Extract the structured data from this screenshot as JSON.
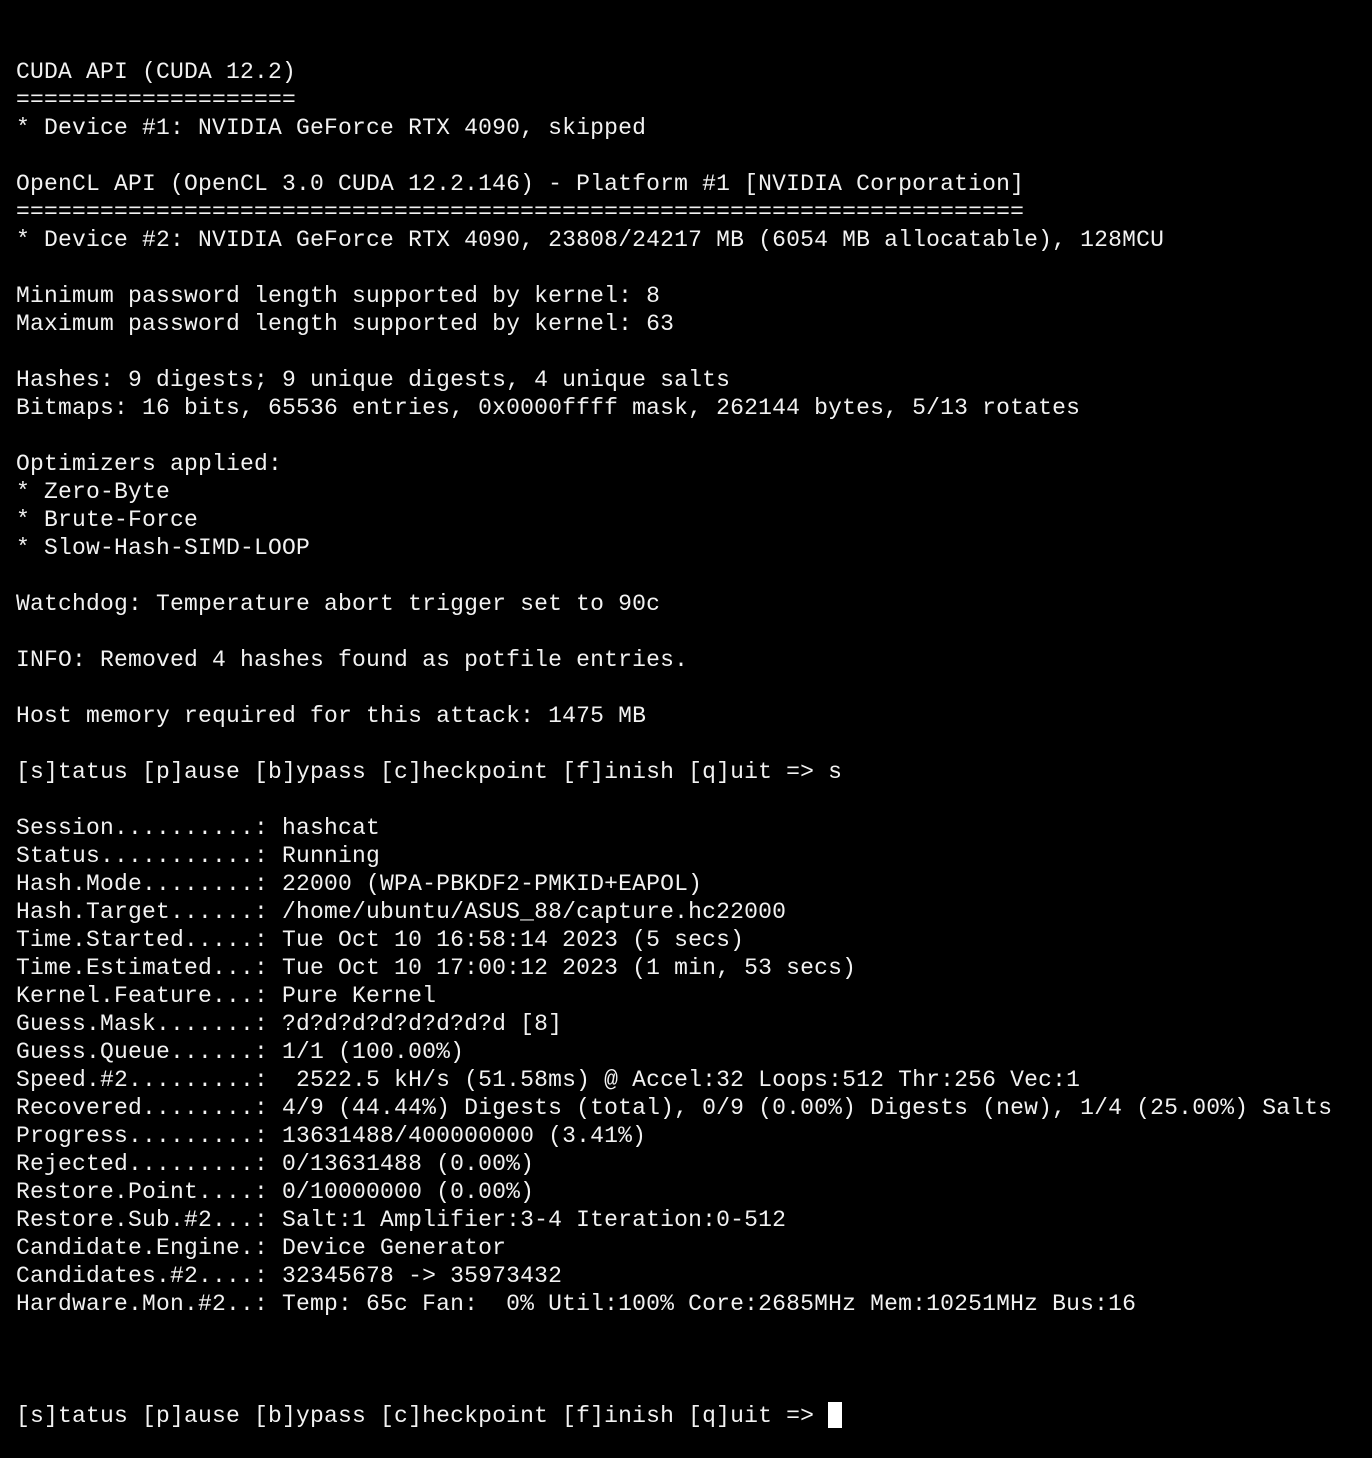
{
  "terminal": {
    "lines": [
      "CUDA API (CUDA 12.2)",
      "====================",
      "* Device #1: NVIDIA GeForce RTX 4090, skipped",
      "",
      "OpenCL API (OpenCL 3.0 CUDA 12.2.146) - Platform #1 [NVIDIA Corporation]",
      "========================================================================",
      "* Device #2: NVIDIA GeForce RTX 4090, 23808/24217 MB (6054 MB allocatable), 128MCU",
      "",
      "Minimum password length supported by kernel: 8",
      "Maximum password length supported by kernel: 63",
      "",
      "Hashes: 9 digests; 9 unique digests, 4 unique salts",
      "Bitmaps: 16 bits, 65536 entries, 0x0000ffff mask, 262144 bytes, 5/13 rotates",
      "",
      "Optimizers applied:",
      "* Zero-Byte",
      "* Brute-Force",
      "* Slow-Hash-SIMD-LOOP",
      "",
      "Watchdog: Temperature abort trigger set to 90c",
      "",
      "INFO: Removed 4 hashes found as potfile entries.",
      "",
      "Host memory required for this attack: 1475 MB",
      "",
      "[s]tatus [p]ause [b]ypass [c]heckpoint [f]inish [q]uit => s",
      "",
      "Session..........: hashcat",
      "Status...........: Running",
      "Hash.Mode........: 22000 (WPA-PBKDF2-PMKID+EAPOL)",
      "Hash.Target......: /home/ubuntu/ASUS_88/capture.hc22000",
      "Time.Started.....: Tue Oct 10 16:58:14 2023 (5 secs)",
      "Time.Estimated...: Tue Oct 10 17:00:12 2023 (1 min, 53 secs)",
      "Kernel.Feature...: Pure Kernel",
      "Guess.Mask.......: ?d?d?d?d?d?d?d?d [8]",
      "Guess.Queue......: 1/1 (100.00%)",
      "Speed.#2.........:  2522.5 kH/s (51.58ms) @ Accel:32 Loops:512 Thr:256 Vec:1",
      "Recovered........: 4/9 (44.44%) Digests (total), 0/9 (0.00%) Digests (new), 1/4 (25.00%) Salts",
      "Progress.........: 13631488/400000000 (3.41%)",
      "Rejected.........: 0/13631488 (0.00%)",
      "Restore.Point....: 0/10000000 (0.00%)",
      "Restore.Sub.#2...: Salt:1 Amplifier:3-4 Iteration:0-512",
      "Candidate.Engine.: Device Generator",
      "Candidates.#2....: 32345678 -> 35973432",
      "Hardware.Mon.#2..: Temp: 65c Fan:  0% Util:100% Core:2685MHz Mem:10251MHz Bus:16",
      ""
    ],
    "prompt": "[s]tatus [p]ause [b]ypass [c]heckpoint [f]inish [q]uit => ",
    "colors": {
      "background": "#000000",
      "foreground": "#f2f2f2",
      "cursor": "#ffffff"
    }
  }
}
